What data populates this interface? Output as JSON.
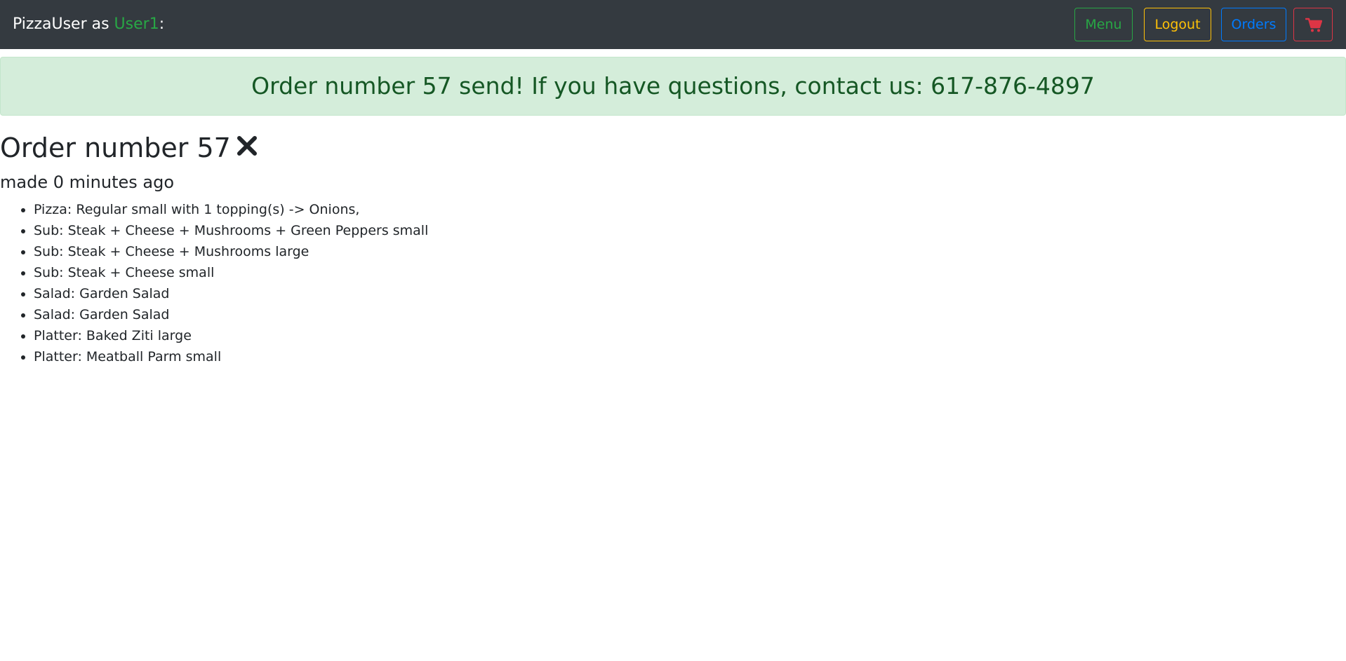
{
  "navbar": {
    "brand_prefix": "PizzaUser as ",
    "username": "User1",
    "brand_suffix": ":",
    "buttons": {
      "menu": "Menu",
      "logout": "Logout",
      "orders": "Orders",
      "cart_icon": "shopping-cart-icon"
    }
  },
  "alert": {
    "message": "Order number 57 send! If you have questions, contact us: 617-876-4897"
  },
  "order": {
    "title": "Order number 57",
    "cancel_icon": "close-icon",
    "time": "made 0 minutes ago",
    "items": [
      "Pizza: Regular small with 1 topping(s) -> Onions,",
      "Sub: Steak + Cheese + Mushrooms + Green Peppers small",
      "Sub: Steak + Cheese + Mushrooms large",
      "Sub: Steak + Cheese small",
      "Salad: Garden Salad",
      "Salad: Garden Salad",
      "Platter: Baked Ziti large",
      "Platter: Meatball Parm small"
    ]
  },
  "colors": {
    "navbar_bg": "#343a40",
    "success": "#28a745",
    "warning": "#ffc107",
    "primary": "#007bff",
    "danger": "#dc3545",
    "alert_bg": "#d4edda",
    "alert_text": "#155724"
  }
}
